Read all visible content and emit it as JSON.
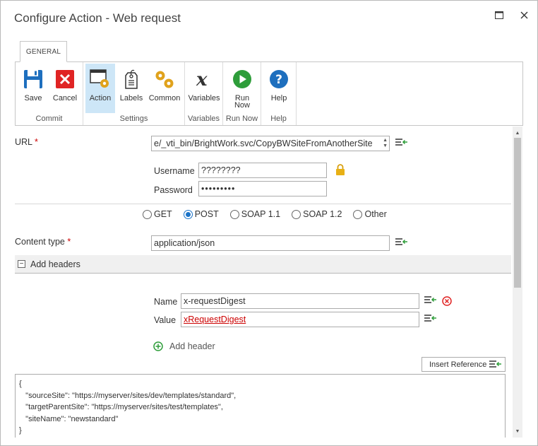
{
  "window": {
    "title": "Configure Action - Web request"
  },
  "ribbon": {
    "tab": "GENERAL",
    "groups": [
      {
        "label": "Commit",
        "buttons": [
          {
            "label": "Save",
            "icon": "save-icon"
          },
          {
            "label": "Cancel",
            "icon": "cancel-icon"
          }
        ]
      },
      {
        "label": "Settings",
        "buttons": [
          {
            "label": "Action",
            "icon": "action-icon",
            "active": true
          },
          {
            "label": "Labels",
            "icon": "labels-icon"
          },
          {
            "label": "Common",
            "icon": "common-icon"
          }
        ]
      },
      {
        "label": "Variables",
        "buttons": [
          {
            "label": "Variables",
            "icon": "variables-icon"
          }
        ]
      },
      {
        "label": "Run Now",
        "buttons": [
          {
            "label": "Run\nNow",
            "icon": "run-now-icon"
          }
        ]
      },
      {
        "label": "Help",
        "buttons": [
          {
            "label": "Help",
            "icon": "help-icon"
          }
        ]
      }
    ]
  },
  "form": {
    "url": {
      "label": "URL",
      "required": "*",
      "value": "e/_vti_bin/BrightWork.svc/CopyBWSiteFromAnotherSite"
    },
    "username": {
      "label": "Username",
      "value": "????????"
    },
    "password": {
      "label": "Password",
      "value": "•••••••••"
    },
    "methods": [
      {
        "label": "GET",
        "selected": false
      },
      {
        "label": "POST",
        "selected": true
      },
      {
        "label": "SOAP 1.1",
        "selected": false
      },
      {
        "label": "SOAP 1.2",
        "selected": false
      },
      {
        "label": "Other",
        "selected": false
      }
    ],
    "content_type": {
      "label": "Content type",
      "required": "*",
      "value": "application/json"
    },
    "headers_section": {
      "label": "Add headers",
      "toggle": "−"
    },
    "header": {
      "name_label": "Name",
      "name_value": "x-requestDigest",
      "value_label": "Value",
      "value_value": "xRequestDigest"
    },
    "add_header": "Add header",
    "insert_reference": "Insert Reference",
    "body_lines": [
      "{",
      "   \"sourceSite\": \"https://myserver/sites/dev/templates/standard\",",
      "   \"targetParentSite\": \"https://myserver/sites/test/templates\",",
      "   \"siteName\": \"newstandard\"",
      "}"
    ]
  },
  "colors": {
    "accent": "#1a73c8",
    "required": "#cc0000",
    "ribbon_active": "#cde6f7",
    "insert_green": "#2e9d3a"
  }
}
